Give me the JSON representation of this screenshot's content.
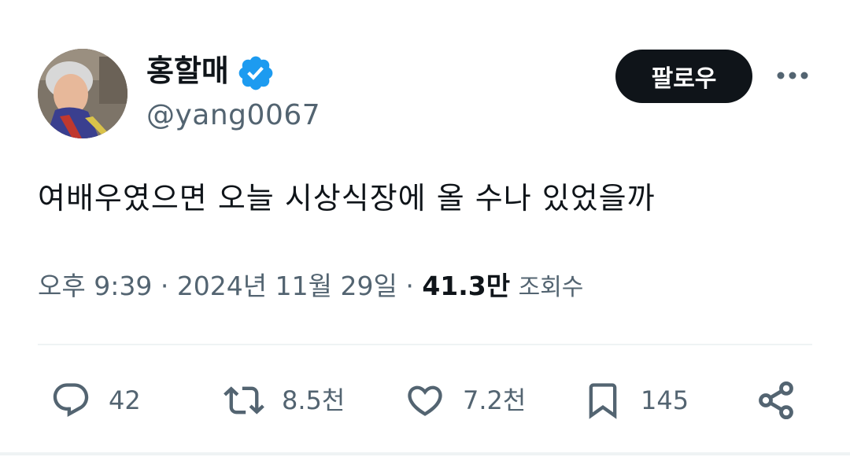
{
  "author": {
    "name": "홍할매",
    "handle": "@yang0067",
    "verified": true
  },
  "follow_label": "팔로우",
  "more_icon": "more-horizontal-icon",
  "tweet": {
    "text": "여배우였으면 오늘 시상식장에 올 수나 있었을까"
  },
  "meta": {
    "time": "오후 9:39",
    "separator": " · ",
    "date": "2024년 11월 29일",
    "views_count": "41.3만",
    "views_label": "조회수"
  },
  "actions": {
    "reply": {
      "icon": "reply-icon",
      "count": "42"
    },
    "retweet": {
      "icon": "retweet-icon",
      "count": "8.5천"
    },
    "like": {
      "icon": "heart-icon",
      "count": "7.2천"
    },
    "bookmark": {
      "icon": "bookmark-icon",
      "count": "145"
    },
    "share": {
      "icon": "share-icon"
    }
  },
  "colors": {
    "text": "#0f1419",
    "secondary": "#536471",
    "verified": "#1d9bf0",
    "divider": "#eff3f4",
    "follow_bg": "#0f1419"
  }
}
